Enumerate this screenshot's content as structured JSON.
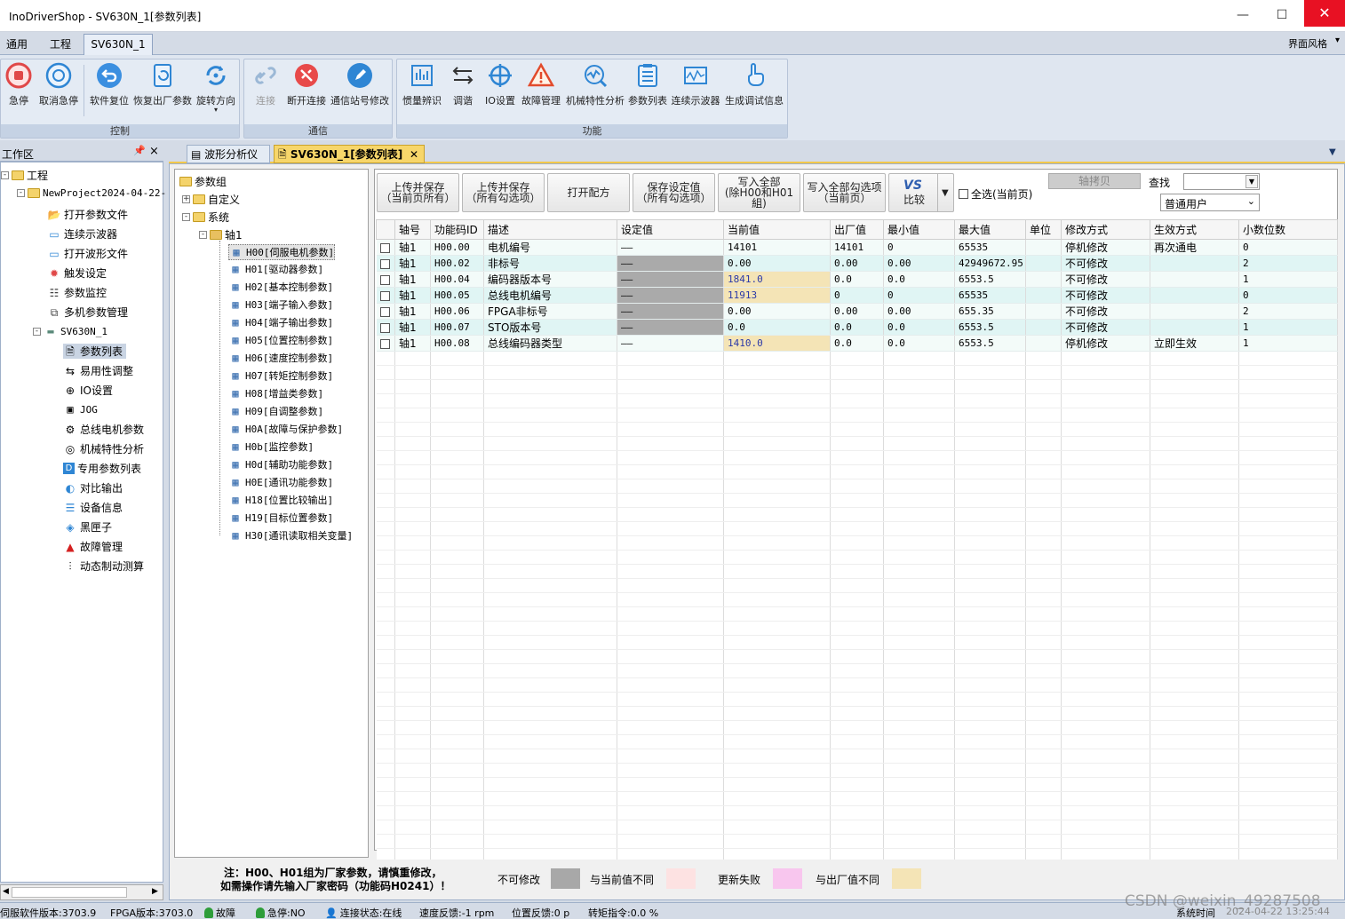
{
  "window": {
    "title": "InoDriverShop - SV630N_1[参数列表]"
  },
  "menu": {
    "items": [
      "通用",
      "工程"
    ],
    "active_tab": "SV630N_1",
    "style_label": "界面风格"
  },
  "ribbon": {
    "groups": [
      {
        "label": "控制",
        "buttons": [
          "急停",
          "取消急停",
          "软件复位",
          "恢复出厂参数",
          "旋转方向"
        ]
      },
      {
        "label": "通信",
        "buttons": [
          "连接",
          "断开连接",
          "通信站号修改"
        ]
      },
      {
        "label": "功能",
        "buttons": [
          "惯量辨识",
          "调谐",
          "IO设置",
          "故障管理",
          "机械特性分析",
          "参数列表",
          "连续示波器",
          "生成调试信息"
        ]
      }
    ]
  },
  "workspace": {
    "title": "工作区",
    "pin": "ᵖ",
    "close": "×",
    "root": "工程",
    "project": "NewProject2024-04-22-",
    "project_items": [
      "打开参数文件",
      "连续示波器",
      "打开波形文件",
      "触发设定",
      "参数监控",
      "多机参数管理"
    ],
    "device": "SV630N_1",
    "device_items": [
      "参数列表",
      "易用性调整",
      "IO设置",
      "JOG",
      "总线电机参数",
      "机械特性分析",
      "专用参数列表",
      "对比输出",
      "设备信息",
      "黑匣子",
      "故障管理",
      "动态制动测算"
    ]
  },
  "doc_tabs": [
    "波形分析仪",
    "SV630N_1[参数列表]"
  ],
  "param_tree": {
    "root": "参数组",
    "custom": "自定义",
    "system": "系统",
    "axis": "轴1",
    "groups": [
      "H00[伺服电机参数]",
      "H01[驱动器参数]",
      "H02[基本控制参数]",
      "H03[端子输入参数]",
      "H04[端子输出参数]",
      "H05[位置控制参数]",
      "H06[速度控制参数]",
      "H07[转矩控制参数]",
      "H08[增益类参数]",
      "H09[自调整参数]",
      "H0A[故障与保护参数]",
      "H0b[监控参数]",
      "H0d[辅助功能参数]",
      "H0E[通讯功能参数]",
      "H18[位置比较输出]",
      "H19[目标位置参数]",
      "H30[通讯读取相关变量]"
    ]
  },
  "toolbar": {
    "upload_save_page": [
      "上传并保存",
      "（当前页所有）"
    ],
    "upload_save_checked": [
      "上传并保存",
      "（所有勾选项）"
    ],
    "open_recipe": "打开配方",
    "save_setting": [
      "保存设定值",
      "（所有勾选项）"
    ],
    "write_all": [
      "写入全部",
      "(除H00和H01組)"
    ],
    "write_checked": [
      "写入全部勾选项",
      "（当前页）"
    ],
    "compare_logo": "VS",
    "compare": "比较",
    "select_all": "全选(当前页)",
    "axis_copy": "轴拷贝",
    "search_label": "查找",
    "search_value": "",
    "user_level": "普通用户"
  },
  "table": {
    "columns": [
      "",
      "轴号",
      "功能码ID",
      "描述",
      "设定值",
      "当前值",
      "出厂值",
      "最小值",
      "最大值",
      "单位",
      "修改方式",
      "生效方式",
      "小数位数"
    ],
    "rows": [
      [
        "",
        "轴1",
        "H00.00",
        "电机编号",
        "——",
        "14101",
        "14101",
        "0",
        "65535",
        "",
        "停机修改",
        "再次通电",
        "0"
      ],
      [
        "",
        "轴1",
        "H00.02",
        "非标号",
        "——",
        "0.00",
        "0.00",
        "0.00",
        "42949672.95",
        "",
        "不可修改",
        "",
        "2"
      ],
      [
        "",
        "轴1",
        "H00.04",
        "编码器版本号",
        "——",
        "1841.0",
        "0.0",
        "0.0",
        "6553.5",
        "",
        "不可修改",
        "",
        "1"
      ],
      [
        "",
        "轴1",
        "H00.05",
        "总线电机编号",
        "——",
        "11913",
        "0",
        "0",
        "65535",
        "",
        "不可修改",
        "",
        "0"
      ],
      [
        "",
        "轴1",
        "H00.06",
        "FPGA非标号",
        "——",
        "0.00",
        "0.00",
        "0.00",
        "655.35",
        "",
        "不可修改",
        "",
        "2"
      ],
      [
        "",
        "轴1",
        "H00.07",
        "STO版本号",
        "——",
        "0.0",
        "0.0",
        "0.0",
        "6553.5",
        "",
        "不可修改",
        "",
        "1"
      ],
      [
        "",
        "轴1",
        "H00.08",
        "总线编码器类型",
        "——",
        "1410.0",
        "0.0",
        "0.0",
        "6553.5",
        "",
        "停机修改",
        "立即生效",
        "1"
      ]
    ]
  },
  "legend": {
    "note1": "注：H00、H01组为厂家参数，请慎重修改，",
    "note2": "如需操作请先输入厂家密码（功能码H0241）！",
    "items": [
      {
        "label": "不可修改",
        "color": "#a8a8a8"
      },
      {
        "label": "与当前值不同",
        "color": "#fde2e2"
      },
      {
        "label": "更新失败",
        "color": "#f8c6ee"
      },
      {
        "label": "与出厂值不同",
        "color": "#f4e4b6"
      }
    ]
  },
  "status": {
    "servo_ver": "伺服软件版本:3703.9",
    "fpga_ver": "FPGA版本:3703.0",
    "fault": "故障",
    "estop": "急停:NO",
    "conn": "连接状态:在线",
    "speed": "速度反馈:-1 rpm",
    "pos": "位置反馈:0 p",
    "torque": "转矩指令:0.0 %",
    "watermark": "CSDN @weixin_49287508",
    "sys_time_label": "系统时间",
    "sys_time": "2024-04-22 13:25:44"
  }
}
